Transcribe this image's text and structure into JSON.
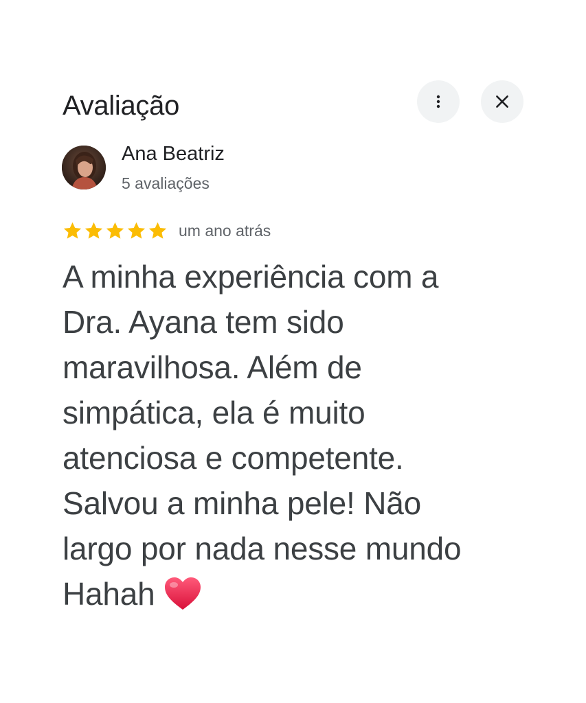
{
  "dialog": {
    "title": "Avaliação",
    "more_icon": "more-vert-icon",
    "close_icon": "close-icon"
  },
  "author": {
    "name": "Ana Beatriz",
    "reviews_count": "5 avaliações",
    "avatar": "user-avatar-photo"
  },
  "review": {
    "rating": 5,
    "rating_max": 5,
    "star_color": "#fbbc04",
    "time": "um ano atrás",
    "lines": [
      "A minha experiência com a",
      "Dra. Ayana tem sido",
      "maravilhosa. Além de",
      "simpática, ela é muito",
      "atenciosa e competente.",
      "Salvou a minha pele! Não",
      "largo por nada nesse mundo",
      "Hahah"
    ],
    "emoji": "heart-icon",
    "emoji_color": "#e8224a"
  }
}
